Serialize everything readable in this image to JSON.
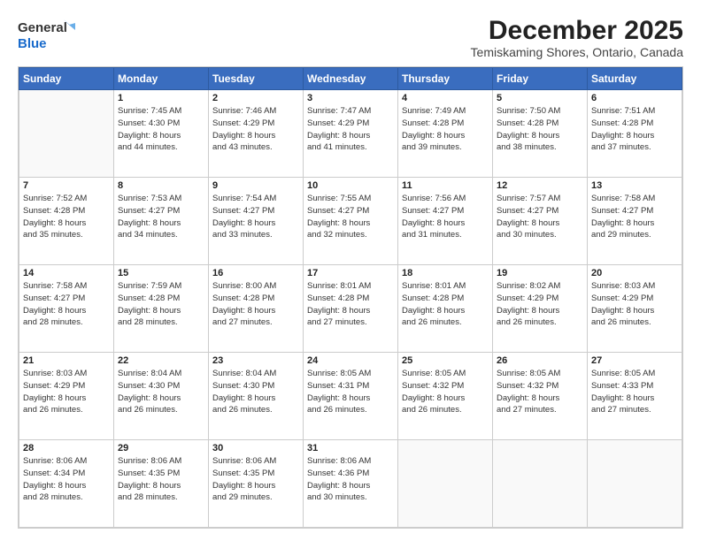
{
  "header": {
    "logo_line1": "General",
    "logo_line2": "Blue",
    "month": "December 2025",
    "location": "Temiskaming Shores, Ontario, Canada"
  },
  "weekdays": [
    "Sunday",
    "Monday",
    "Tuesday",
    "Wednesday",
    "Thursday",
    "Friday",
    "Saturday"
  ],
  "weeks": [
    [
      {
        "day": "",
        "info": ""
      },
      {
        "day": "1",
        "info": "Sunrise: 7:45 AM\nSunset: 4:30 PM\nDaylight: 8 hours\nand 44 minutes."
      },
      {
        "day": "2",
        "info": "Sunrise: 7:46 AM\nSunset: 4:29 PM\nDaylight: 8 hours\nand 43 minutes."
      },
      {
        "day": "3",
        "info": "Sunrise: 7:47 AM\nSunset: 4:29 PM\nDaylight: 8 hours\nand 41 minutes."
      },
      {
        "day": "4",
        "info": "Sunrise: 7:49 AM\nSunset: 4:28 PM\nDaylight: 8 hours\nand 39 minutes."
      },
      {
        "day": "5",
        "info": "Sunrise: 7:50 AM\nSunset: 4:28 PM\nDaylight: 8 hours\nand 38 minutes."
      },
      {
        "day": "6",
        "info": "Sunrise: 7:51 AM\nSunset: 4:28 PM\nDaylight: 8 hours\nand 37 minutes."
      }
    ],
    [
      {
        "day": "7",
        "info": "Sunrise: 7:52 AM\nSunset: 4:28 PM\nDaylight: 8 hours\nand 35 minutes."
      },
      {
        "day": "8",
        "info": "Sunrise: 7:53 AM\nSunset: 4:27 PM\nDaylight: 8 hours\nand 34 minutes."
      },
      {
        "day": "9",
        "info": "Sunrise: 7:54 AM\nSunset: 4:27 PM\nDaylight: 8 hours\nand 33 minutes."
      },
      {
        "day": "10",
        "info": "Sunrise: 7:55 AM\nSunset: 4:27 PM\nDaylight: 8 hours\nand 32 minutes."
      },
      {
        "day": "11",
        "info": "Sunrise: 7:56 AM\nSunset: 4:27 PM\nDaylight: 8 hours\nand 31 minutes."
      },
      {
        "day": "12",
        "info": "Sunrise: 7:57 AM\nSunset: 4:27 PM\nDaylight: 8 hours\nand 30 minutes."
      },
      {
        "day": "13",
        "info": "Sunrise: 7:58 AM\nSunset: 4:27 PM\nDaylight: 8 hours\nand 29 minutes."
      }
    ],
    [
      {
        "day": "14",
        "info": "Sunrise: 7:58 AM\nSunset: 4:27 PM\nDaylight: 8 hours\nand 28 minutes."
      },
      {
        "day": "15",
        "info": "Sunrise: 7:59 AM\nSunset: 4:28 PM\nDaylight: 8 hours\nand 28 minutes."
      },
      {
        "day": "16",
        "info": "Sunrise: 8:00 AM\nSunset: 4:28 PM\nDaylight: 8 hours\nand 27 minutes."
      },
      {
        "day": "17",
        "info": "Sunrise: 8:01 AM\nSunset: 4:28 PM\nDaylight: 8 hours\nand 27 minutes."
      },
      {
        "day": "18",
        "info": "Sunrise: 8:01 AM\nSunset: 4:28 PM\nDaylight: 8 hours\nand 26 minutes."
      },
      {
        "day": "19",
        "info": "Sunrise: 8:02 AM\nSunset: 4:29 PM\nDaylight: 8 hours\nand 26 minutes."
      },
      {
        "day": "20",
        "info": "Sunrise: 8:03 AM\nSunset: 4:29 PM\nDaylight: 8 hours\nand 26 minutes."
      }
    ],
    [
      {
        "day": "21",
        "info": "Sunrise: 8:03 AM\nSunset: 4:29 PM\nDaylight: 8 hours\nand 26 minutes."
      },
      {
        "day": "22",
        "info": "Sunrise: 8:04 AM\nSunset: 4:30 PM\nDaylight: 8 hours\nand 26 minutes."
      },
      {
        "day": "23",
        "info": "Sunrise: 8:04 AM\nSunset: 4:30 PM\nDaylight: 8 hours\nand 26 minutes."
      },
      {
        "day": "24",
        "info": "Sunrise: 8:05 AM\nSunset: 4:31 PM\nDaylight: 8 hours\nand 26 minutes."
      },
      {
        "day": "25",
        "info": "Sunrise: 8:05 AM\nSunset: 4:32 PM\nDaylight: 8 hours\nand 26 minutes."
      },
      {
        "day": "26",
        "info": "Sunrise: 8:05 AM\nSunset: 4:32 PM\nDaylight: 8 hours\nand 27 minutes."
      },
      {
        "day": "27",
        "info": "Sunrise: 8:05 AM\nSunset: 4:33 PM\nDaylight: 8 hours\nand 27 minutes."
      }
    ],
    [
      {
        "day": "28",
        "info": "Sunrise: 8:06 AM\nSunset: 4:34 PM\nDaylight: 8 hours\nand 28 minutes."
      },
      {
        "day": "29",
        "info": "Sunrise: 8:06 AM\nSunset: 4:35 PM\nDaylight: 8 hours\nand 28 minutes."
      },
      {
        "day": "30",
        "info": "Sunrise: 8:06 AM\nSunset: 4:35 PM\nDaylight: 8 hours\nand 29 minutes."
      },
      {
        "day": "31",
        "info": "Sunrise: 8:06 AM\nSunset: 4:36 PM\nDaylight: 8 hours\nand 30 minutes."
      },
      {
        "day": "",
        "info": ""
      },
      {
        "day": "",
        "info": ""
      },
      {
        "day": "",
        "info": ""
      }
    ]
  ]
}
